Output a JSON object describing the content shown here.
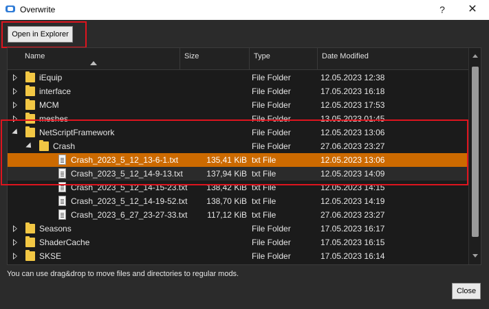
{
  "window": {
    "title": "Overwrite",
    "help_label": "?",
    "close_label": "✕",
    "icon": "app-icon"
  },
  "toolbar": {
    "open_explorer_label": "Open in Explorer"
  },
  "columns": {
    "name": "Name",
    "size": "Size",
    "type": "Type",
    "date": "Date Modified"
  },
  "rows": [
    {
      "name": "iEquip",
      "size": "",
      "type": "File Folder",
      "date": "12.05.2023 12:38",
      "kind": "folder",
      "expander": "closed"
    },
    {
      "name": "interface",
      "size": "",
      "type": "File Folder",
      "date": "17.05.2023 16:18",
      "kind": "folder",
      "expander": "closed"
    },
    {
      "name": "MCM",
      "size": "",
      "type": "File Folder",
      "date": "12.05.2023 17:53",
      "kind": "folder",
      "expander": "closed"
    },
    {
      "name": "meshes",
      "size": "",
      "type": "File Folder",
      "date": "13.05.2023 01:45",
      "kind": "folder",
      "expander": "closed"
    },
    {
      "name": "NetScriptFramework",
      "size": "",
      "type": "File Folder",
      "date": "12.05.2023 13:06",
      "kind": "folder",
      "expander": "open"
    },
    {
      "name": "Crash",
      "size": "",
      "type": "File Folder",
      "date": "27.06.2023 23:27",
      "kind": "folder",
      "expander": "open"
    },
    {
      "name": "Crash_2023_5_12_13-6-1.txt",
      "size": "135,41 KiB",
      "type": "txt File",
      "date": "12.05.2023 13:06",
      "kind": "file",
      "expander": ""
    },
    {
      "name": "Crash_2023_5_12_14-9-13.txt",
      "size": "137,94 KiB",
      "type": "txt File",
      "date": "12.05.2023 14:09",
      "kind": "file",
      "expander": ""
    },
    {
      "name": "Crash_2023_5_12_14-15-23.txt",
      "size": "138,42 KiB",
      "type": "txt File",
      "date": "12.05.2023 14:15",
      "kind": "file",
      "expander": ""
    },
    {
      "name": "Crash_2023_5_12_14-19-52.txt",
      "size": "138,70 KiB",
      "type": "txt File",
      "date": "12.05.2023 14:19",
      "kind": "file",
      "expander": ""
    },
    {
      "name": "Crash_2023_6_27_23-27-33.txt",
      "size": "117,12 KiB",
      "type": "txt File",
      "date": "27.06.2023 23:27",
      "kind": "file",
      "expander": ""
    },
    {
      "name": "Seasons",
      "size": "",
      "type": "File Folder",
      "date": "17.05.2023 16:17",
      "kind": "folder",
      "expander": "closed"
    },
    {
      "name": "ShaderCache",
      "size": "",
      "type": "File Folder",
      "date": "17.05.2023 16:15",
      "kind": "folder",
      "expander": "closed"
    },
    {
      "name": "SKSE",
      "size": "",
      "type": "File Folder",
      "date": "17.05.2023 16:14",
      "kind": "folder",
      "expander": "closed"
    }
  ],
  "hint": "You can use drag&drop to move files and directories to regular mods.",
  "footer": {
    "close_label": "Close"
  },
  "colors": {
    "selection": "#cc6a00",
    "highlight_box": "#e0141e",
    "folder": "#f2c744"
  }
}
